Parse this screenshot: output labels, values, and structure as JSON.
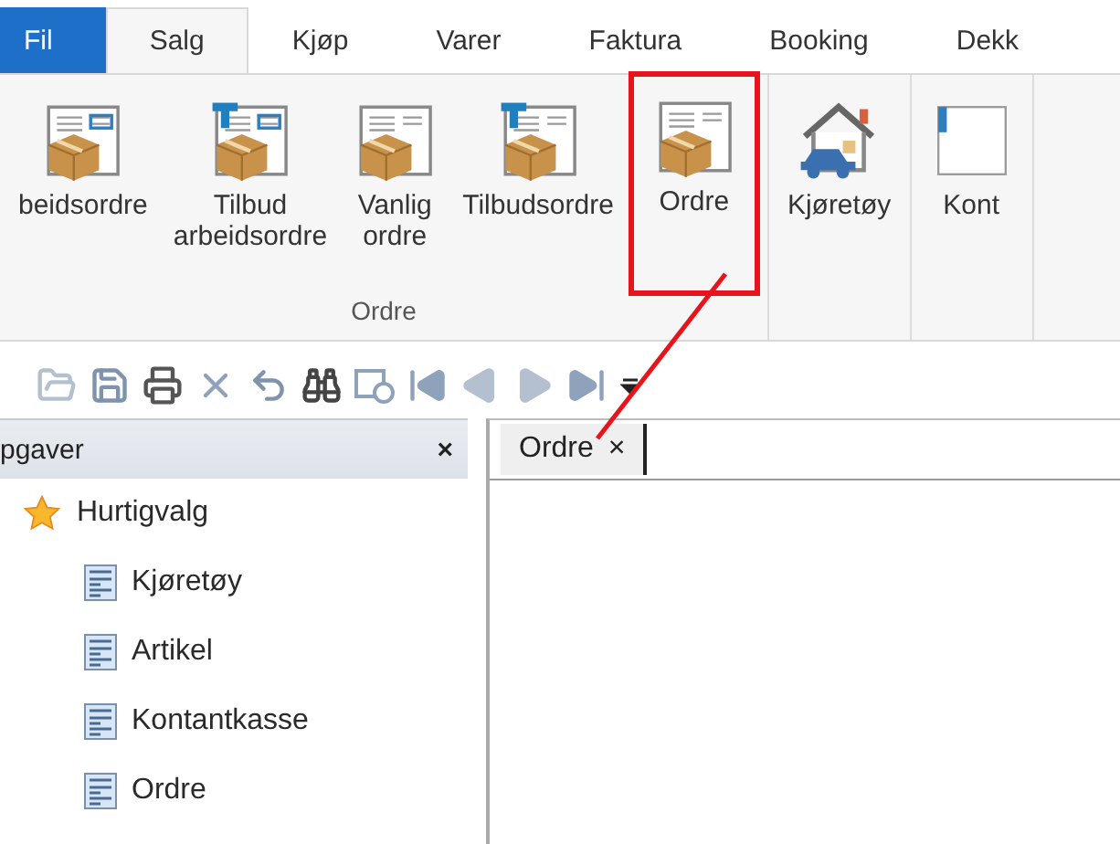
{
  "menu_tabs": [
    {
      "label": "Fil",
      "kind": "file",
      "selected": false
    },
    {
      "label": "Salg",
      "kind": "tab",
      "selected": true
    },
    {
      "label": "Kjøp",
      "kind": "tab",
      "selected": false
    },
    {
      "label": "Varer",
      "kind": "tab",
      "selected": false
    },
    {
      "label": "Faktura",
      "kind": "tab",
      "selected": false
    },
    {
      "label": "Booking",
      "kind": "tab",
      "selected": false
    },
    {
      "label": "Dekk",
      "kind": "tab",
      "selected": false
    }
  ],
  "ribbon": {
    "groups": [
      {
        "label": "Ordre",
        "buttons": [
          {
            "lines": [
              "beidsordre"
            ],
            "kind": "work-order",
            "annotated": false
          },
          {
            "lines": [
              "Tilbud",
              "arbeidsordre"
            ],
            "kind": "quote-work-order",
            "annotated": false
          },
          {
            "lines": [
              "Vanlig",
              "ordre"
            ],
            "kind": "order",
            "annotated": false
          },
          {
            "lines": [
              "Tilbudsordre"
            ],
            "kind": "quote-order",
            "annotated": false
          },
          {
            "lines": [
              "Ordre"
            ],
            "kind": "order",
            "annotated": true
          }
        ]
      },
      {
        "buttons": [
          {
            "lines": [
              "Kjøretøy"
            ],
            "kind": "vehicle",
            "annotated": false
          }
        ]
      },
      {
        "buttons": [
          {
            "lines": [
              "Kont"
            ],
            "kind": "partial",
            "annotated": false
          }
        ]
      }
    ]
  },
  "tasks_panel": {
    "title": "pgaver",
    "close": "×",
    "tree": [
      {
        "label": "Hurtigvalg",
        "kind": "favorites",
        "children": [
          {
            "label": "Kjøretøy",
            "kind": "form"
          },
          {
            "label": "Artikel",
            "kind": "form"
          },
          {
            "label": "Kontantkasse",
            "kind": "form"
          },
          {
            "label": "Ordre",
            "kind": "form"
          }
        ]
      }
    ]
  },
  "document_tabs": [
    {
      "label": "Ordre",
      "close": "×",
      "selected": true
    }
  ]
}
